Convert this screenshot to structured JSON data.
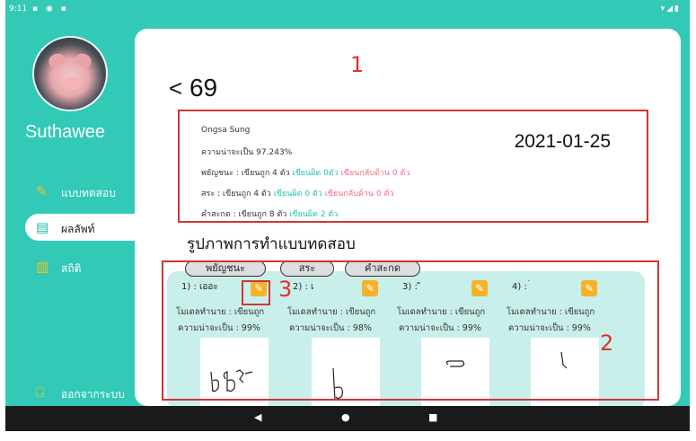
{
  "status_bar": {
    "time": "9:11",
    "right_icons": "wifi-signal-battery"
  },
  "profile": {
    "name": "Suthawee"
  },
  "sidebar": {
    "items": [
      {
        "label": "แบบทดสอบ",
        "icon": "pencil-icon"
      },
      {
        "label": "ผลลัพท์",
        "icon": "document-icon"
      },
      {
        "label": "สถิติ",
        "icon": "bar-chart-icon"
      },
      {
        "label": "ออกจากระบบ",
        "icon": "logout-icon"
      }
    ]
  },
  "annotations": {
    "a1": "1",
    "a2": "2",
    "a3": "3"
  },
  "header": {
    "back_symbol": "<",
    "title": "69"
  },
  "info": {
    "name": "Ongsa Sung",
    "date": "2021-01-25",
    "confidence": "ความน่าจะเป็น 97.243%",
    "consonant": {
      "prefix": "พยัญชนะ : เขียนถูก 4 ตัว",
      "near": "เขียนผิด 0ตัว",
      "mirror": "เขียนกลับด้าน 0 ตัว"
    },
    "vowel": {
      "prefix": "สระ : เขียนถูก 4 ตัว",
      "near": "เขียนผิด 0 ตัว",
      "mirror": "เขียนกลับด้าน 0 ตัว"
    },
    "word": {
      "prefix": "คำสะกด : เขียนถูก 8 ตัว",
      "near": "เขียนผิด 2 ตัว"
    }
  },
  "section_title": "รูปภาพการทำแบบทดสอบ",
  "category_tabs": [
    "พยัญชนะ",
    "สระ",
    "คำสะกด"
  ],
  "items": [
    {
      "label": "1) : เออะ",
      "prediction": "โมเดลทำนาย : เขียนถูก",
      "confidence": "ความน่าจะเป็น : 99%"
    },
    {
      "label": "2) : เ",
      "prediction": "โมเดลทำนาย : เขียนถูก",
      "confidence": "ความน่าจะเป็น : 98%"
    },
    {
      "label": "3) : ั",
      "prediction": "โมเดลทำนาย : เขียนถูก",
      "confidence": "ความน่าจะเป็น : 99%"
    },
    {
      "label": "4) : ่",
      "prediction": "โมเดลทำนาย : เขียนถูก",
      "confidence": "ความน่าจะเป็น : 99%"
    }
  ],
  "nav_bar": {
    "back": "◀",
    "home": "●",
    "recent": "■"
  }
}
